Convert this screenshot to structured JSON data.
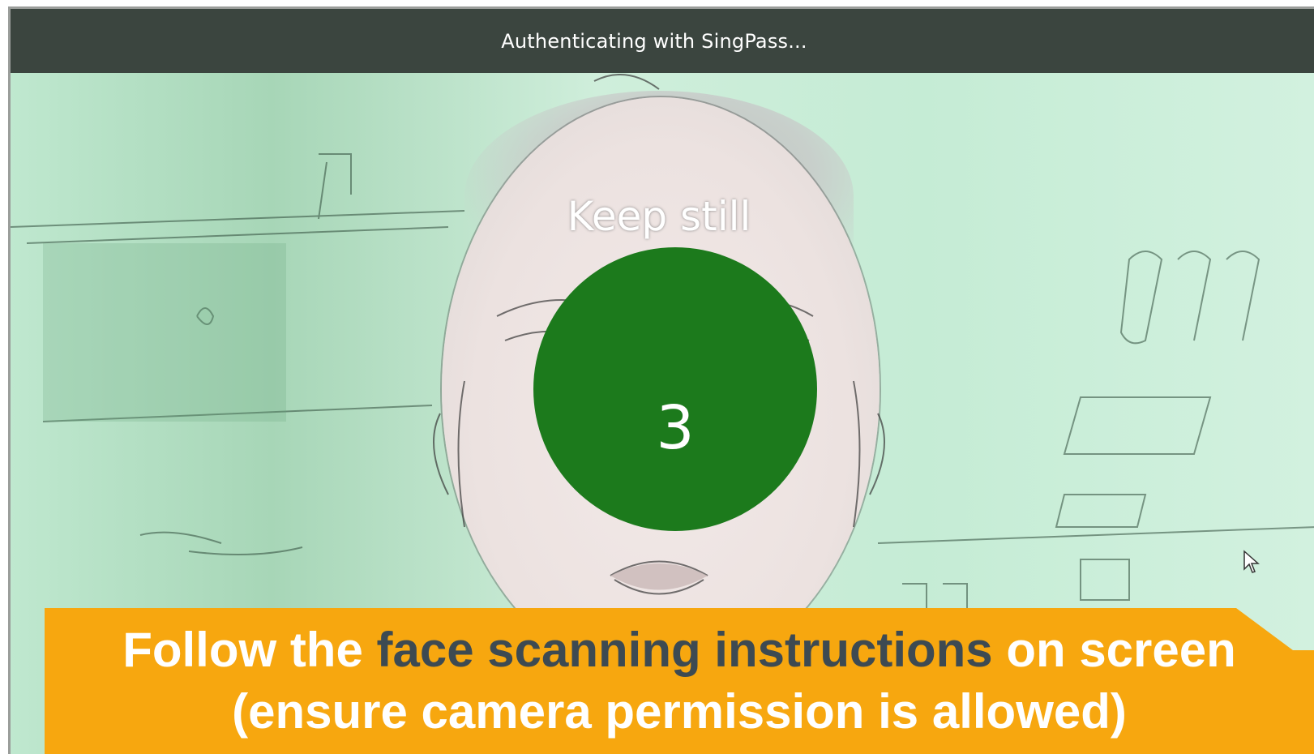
{
  "window": {
    "title": "Authenticating with SingPass..."
  },
  "scan": {
    "prompt": "Keep still",
    "countdown": "3"
  },
  "banner": {
    "line1_part1": "Follow the ",
    "line1_highlight": "face scanning instructions",
    "line1_part2": " on screen",
    "line2": "(ensure camera permission is allowed)"
  },
  "colors": {
    "titlebar": "#3b453f",
    "camera_tint": "#c4ecd4",
    "countdown_circle": "#1c7a1c",
    "banner": "#f7a70f",
    "banner_highlight_text": "#3d4a52"
  }
}
